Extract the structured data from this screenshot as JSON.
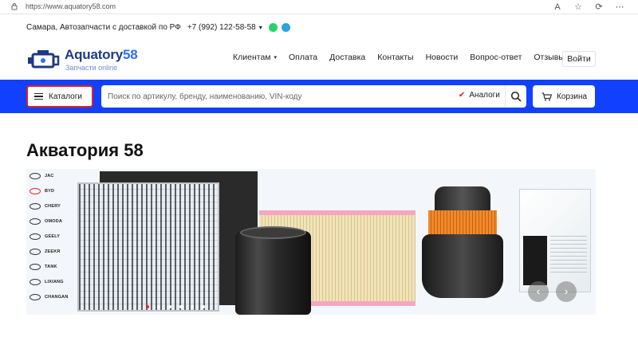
{
  "browser": {
    "url": "https://www.aquatory58.com"
  },
  "topline": {
    "location": "Самара, Автозапчасти с доставкой по РФ",
    "phone": "+7 (992) 122-58-58"
  },
  "logo": {
    "name_main": "Aquatory",
    "name_num": "58",
    "tagline": "Запчасти online",
    "brand_color": "#1d3a86",
    "accent_color": "#2f6ff5"
  },
  "nav": {
    "items": [
      {
        "label": "Клиентам"
      },
      {
        "label": "Оплата"
      },
      {
        "label": "Доставка"
      },
      {
        "label": "Контакты"
      },
      {
        "label": "Новости"
      },
      {
        "label": "Вопрос-ответ"
      },
      {
        "label": "Отзывы"
      }
    ],
    "login": "Войти"
  },
  "searchbar": {
    "catalog_label": "Каталоги",
    "placeholder": "Поиск по артикулу, бренду, наименованию, VIN-коду",
    "analogs_label": "Аналоги",
    "cart_label": "Корзина",
    "bar_color": "#1140ff"
  },
  "main": {
    "title": "Акватория 58"
  },
  "banner": {
    "brands": [
      "JAC",
      "BYD",
      "CHERY",
      "OMODA",
      "GEELY",
      "ZEEKR",
      "TANK",
      "LIXIANG",
      "CHANGAN"
    ],
    "slide_count": 6,
    "active_slide": 1,
    "prev_arrow": "‹",
    "next_arrow": "›"
  }
}
